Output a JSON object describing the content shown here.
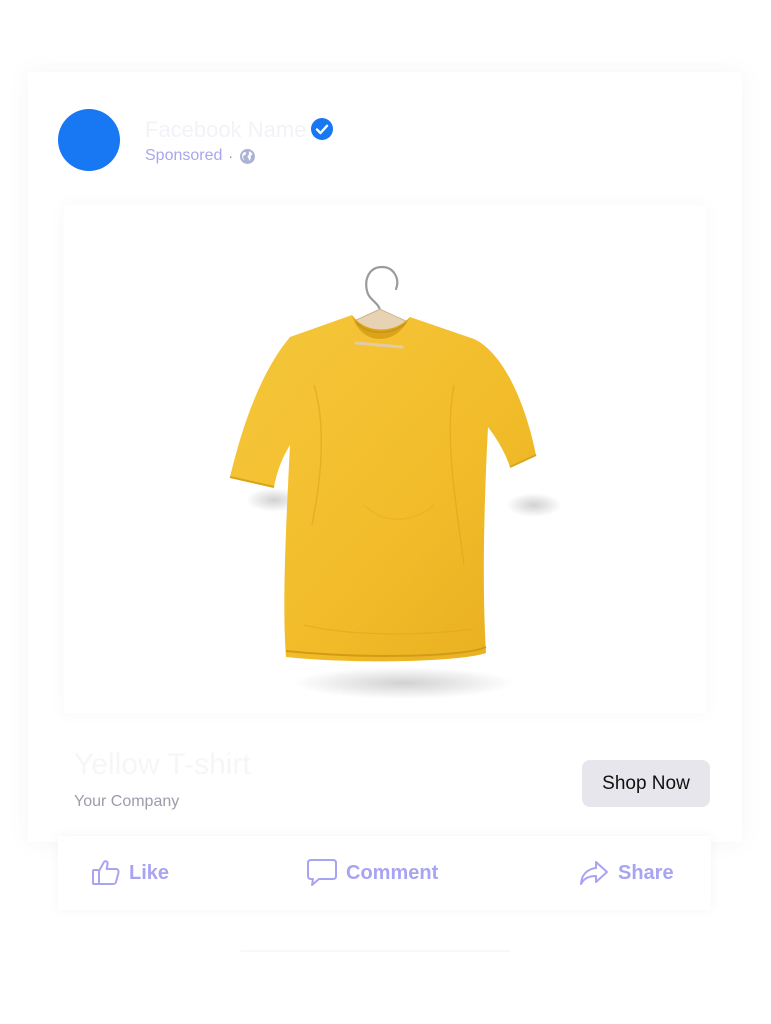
{
  "post": {
    "page_name": "Facebook Name",
    "sponsored_label": "Sponsored",
    "separator": "·",
    "product_title": "Yellow T-shirt",
    "company": "Your Company",
    "cta_label": "Shop Now"
  },
  "actions": {
    "like": "Like",
    "comment": "Comment",
    "share": "Share"
  },
  "icons": {
    "verified": "verified-badge-icon",
    "audience": "globe-icon",
    "like": "thumbs-up-icon",
    "comment": "speech-bubble-icon",
    "share": "share-arrow-icon"
  },
  "colors": {
    "brand_blue": "#1877f2",
    "action_purple": "#a9a4f2",
    "shirt_yellow": "#f2bf2e",
    "button_gray": "#e6e6ec"
  }
}
